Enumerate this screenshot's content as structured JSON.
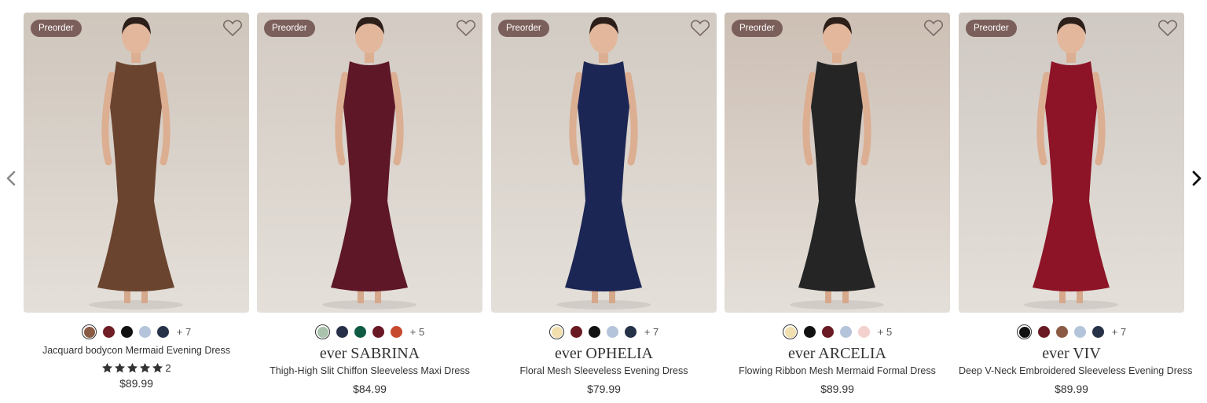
{
  "nav": {
    "prev_icon": "chevron-left-icon",
    "next_icon": "chevron-right-icon"
  },
  "products": [
    {
      "badge": "Preorder",
      "brand": "",
      "title": "Jacquard bodycon Mermaid Evening Dress",
      "rating_stars": 5,
      "rating_count": "2",
      "price": "$89.99",
      "dress_color": "#6b4430",
      "swatches": [
        "#8a5a44",
        "#6e1e24",
        "#111111",
        "#b4c4da",
        "#263248"
      ],
      "selected_swatch": 0,
      "more_colors": "+ 7"
    },
    {
      "badge": "Preorder",
      "brand": "ever SABRINA",
      "title": "Thigh-High Slit Chiffon Sleeveless Maxi Dress",
      "price": "$84.99",
      "dress_color": "#5e1727",
      "swatches": [
        "#a9c3ad",
        "#253048",
        "#0f5a43",
        "#6a1726",
        "#c84a2e"
      ],
      "selected_swatch": 0,
      "more_colors": "+ 5"
    },
    {
      "badge": "Preorder",
      "brand": "ever OPHELIA",
      "title": "Floral Mesh Sleeveless Evening Dress",
      "price": "$79.99",
      "dress_color": "#1c2654",
      "swatches": [
        "#f1dfae",
        "#6a1a22",
        "#111111",
        "#b4c4da",
        "#263248"
      ],
      "selected_swatch": 0,
      "more_colors": "+ 7"
    },
    {
      "badge": "Preorder",
      "brand": "ever ARCELIA",
      "title": "Flowing Ribbon Mesh Mermaid Formal Dress",
      "price": "$89.99",
      "dress_color": "#252526",
      "swatches": [
        "#f1dfae",
        "#111111",
        "#6a1a22",
        "#b4c4da",
        "#f3d1cf"
      ],
      "selected_swatch": 0,
      "more_colors": "+ 5"
    },
    {
      "badge": "Preorder",
      "brand": "ever VIV",
      "title": "Deep V-Neck Embroidered Sleeveless Evening Dress",
      "price": "$89.99",
      "dress_color": "#8c1426",
      "swatches": [
        "#111111",
        "#6a1a22",
        "#8a5a44",
        "#b4c4da",
        "#263248"
      ],
      "selected_swatch": 0,
      "more_colors": "+ 7"
    }
  ]
}
